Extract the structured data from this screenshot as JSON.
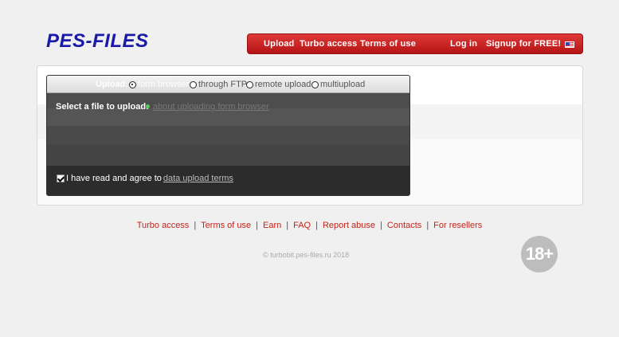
{
  "logo": "PES-FILES",
  "topnav": {
    "upload": "Upload",
    "turbo_access": "Turbo access",
    "terms_of_use": "Terms of use",
    "log_in": "Log in",
    "signup": "Signup for FREE!",
    "language_icon": "us-flag-icon"
  },
  "upload_box": {
    "upload_label": "Upload:",
    "options": [
      {
        "label": "form browser",
        "selected": true
      },
      {
        "label": "through FTP",
        "selected": false
      },
      {
        "label": "remote upload",
        "selected": false
      },
      {
        "label": "multiupload",
        "selected": false
      }
    ],
    "select_file_label": "Select a file to upload:",
    "about_link": "about uploading form browser",
    "agree_text": "I have read and agree to",
    "agree_link": "data upload terms",
    "agree_checked": true
  },
  "footer": {
    "links": [
      "Turbo access",
      "Terms of use",
      "Earn",
      "FAQ",
      "Report abuse",
      "Contacts",
      "For resellers"
    ],
    "copyright": "© turbobit.pes-files.ru 2018",
    "age_badge": "18+"
  },
  "colors": {
    "nav_red": "#c81e1e",
    "link_red": "#c0241d",
    "logo_blue": "#1a1aa8"
  }
}
